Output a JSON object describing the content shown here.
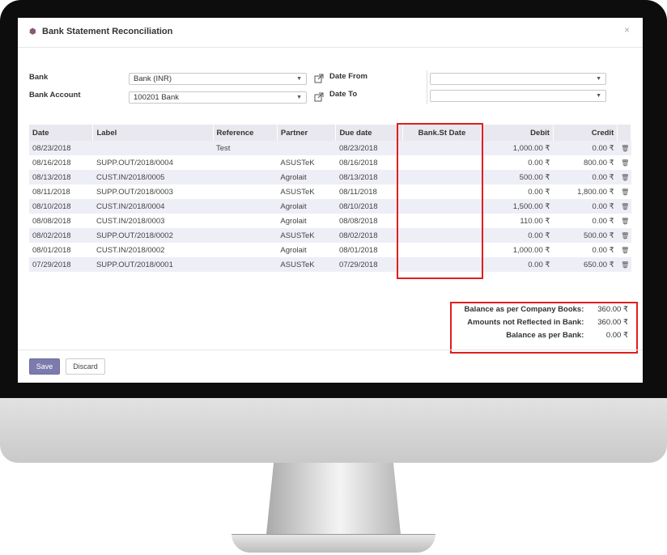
{
  "dialog": {
    "title": "Bank Statement Reconciliation",
    "close": "×"
  },
  "form": {
    "bank_label": "Bank",
    "bank_value": "Bank (INR)",
    "account_label": "Bank Account",
    "account_value": "100201 Bank",
    "date_from_label": "Date From",
    "date_from_value": "",
    "date_to_label": "Date To",
    "date_to_value": ""
  },
  "table": {
    "columns": [
      "Date",
      "Label",
      "Reference",
      "Partner",
      "Due date",
      "Bank.St Date",
      "Debit",
      "Credit"
    ],
    "rows": [
      [
        "08/23/2018",
        "",
        "Test",
        "",
        "08/23/2018",
        "",
        "1,000.00 ₹",
        "0.00 ₹"
      ],
      [
        "08/16/2018",
        "SUPP.OUT/2018/0004",
        "",
        "ASUSTeK",
        "08/16/2018",
        "",
        "0.00 ₹",
        "800.00 ₹"
      ],
      [
        "08/13/2018",
        "CUST.IN/2018/0005",
        "",
        "Agrolait",
        "08/13/2018",
        "",
        "500.00 ₹",
        "0.00 ₹"
      ],
      [
        "08/11/2018",
        "SUPP.OUT/2018/0003",
        "",
        "ASUSTeK",
        "08/11/2018",
        "",
        "0.00 ₹",
        "1,800.00 ₹"
      ],
      [
        "08/10/2018",
        "CUST.IN/2018/0004",
        "",
        "Agrolait",
        "08/10/2018",
        "",
        "1,500.00 ₹",
        "0.00 ₹"
      ],
      [
        "08/08/2018",
        "CUST.IN/2018/0003",
        "",
        "Agrolait",
        "08/08/2018",
        "",
        "110.00 ₹",
        "0.00 ₹"
      ],
      [
        "08/02/2018",
        "SUPP.OUT/2018/0002",
        "",
        "ASUSTeK",
        "08/02/2018",
        "",
        "0.00 ₹",
        "500.00 ₹"
      ],
      [
        "08/01/2018",
        "CUST.IN/2018/0002",
        "",
        "Agrolait",
        "08/01/2018",
        "",
        "1,000.00 ₹",
        "0.00 ₹"
      ],
      [
        "07/29/2018",
        "SUPP.OUT/2018/0001",
        "",
        "ASUSTeK",
        "07/29/2018",
        "",
        "0.00 ₹",
        "650.00 ₹"
      ]
    ]
  },
  "totals": {
    "company_books_label": "Balance as per Company Books:",
    "company_books_value": "360.00 ₹",
    "not_reflected_label": "Amounts not Reflected in Bank:",
    "not_reflected_value": "360.00 ₹",
    "bank_balance_label": "Balance as per Bank:",
    "bank_balance_value": "0.00 ₹"
  },
  "buttons": {
    "save": "Save",
    "discard": "Discard"
  },
  "colors": {
    "highlight": "#e01e1e",
    "primary": "#7c7bad",
    "brand": "#875a7b"
  }
}
